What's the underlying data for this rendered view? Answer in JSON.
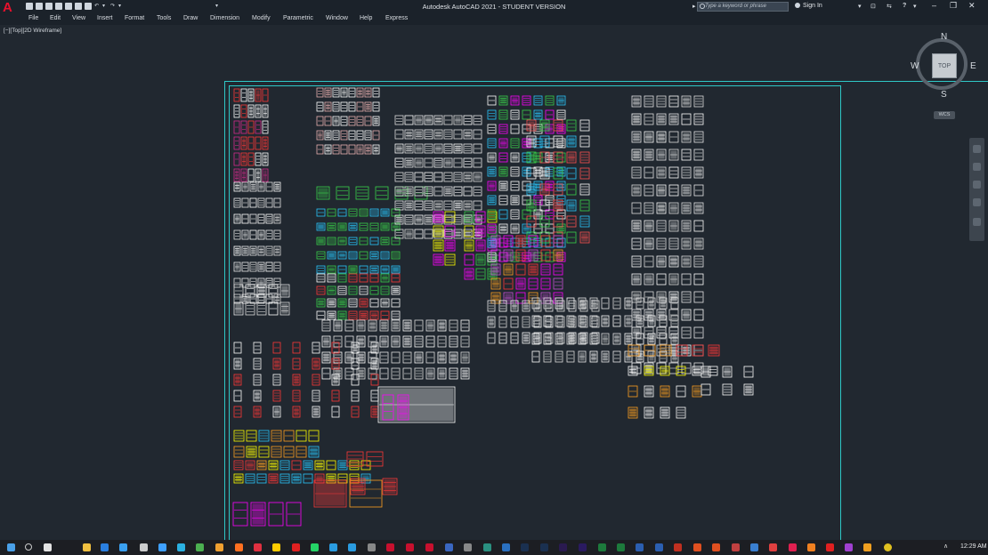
{
  "window": {
    "title": "Autodesk AutoCAD 2021 - STUDENT VERSION",
    "app_logo": "A",
    "search_placeholder": "Type a keyword or phrase",
    "signin_label": "Sign In",
    "help_label": "?"
  },
  "menus": [
    "File",
    "Edit",
    "View",
    "Insert",
    "Format",
    "Tools",
    "Draw",
    "Dimension",
    "Modify",
    "Parametric",
    "Window",
    "Help",
    "Express"
  ],
  "viewport": {
    "label": "[−][Top][2D Wireframe]"
  },
  "viewcube": {
    "top": "TOP",
    "north": "N",
    "south": "S",
    "east": "E",
    "west": "W",
    "wcs": "WCS"
  },
  "taskbar": {
    "time": "12:29 AM"
  },
  "colors": {
    "background": "#212830",
    "frame": "#2fc8c7",
    "blocks": [
      "#ffffff",
      "#e0e0e0",
      "#ff3838",
      "#d42a8a",
      "#e8b0b0",
      "#3ad24a",
      "#28c8ff",
      "#ff00ff",
      "#ffff00",
      "#ffa020",
      "#c850d8",
      "#ff5050"
    ]
  }
}
